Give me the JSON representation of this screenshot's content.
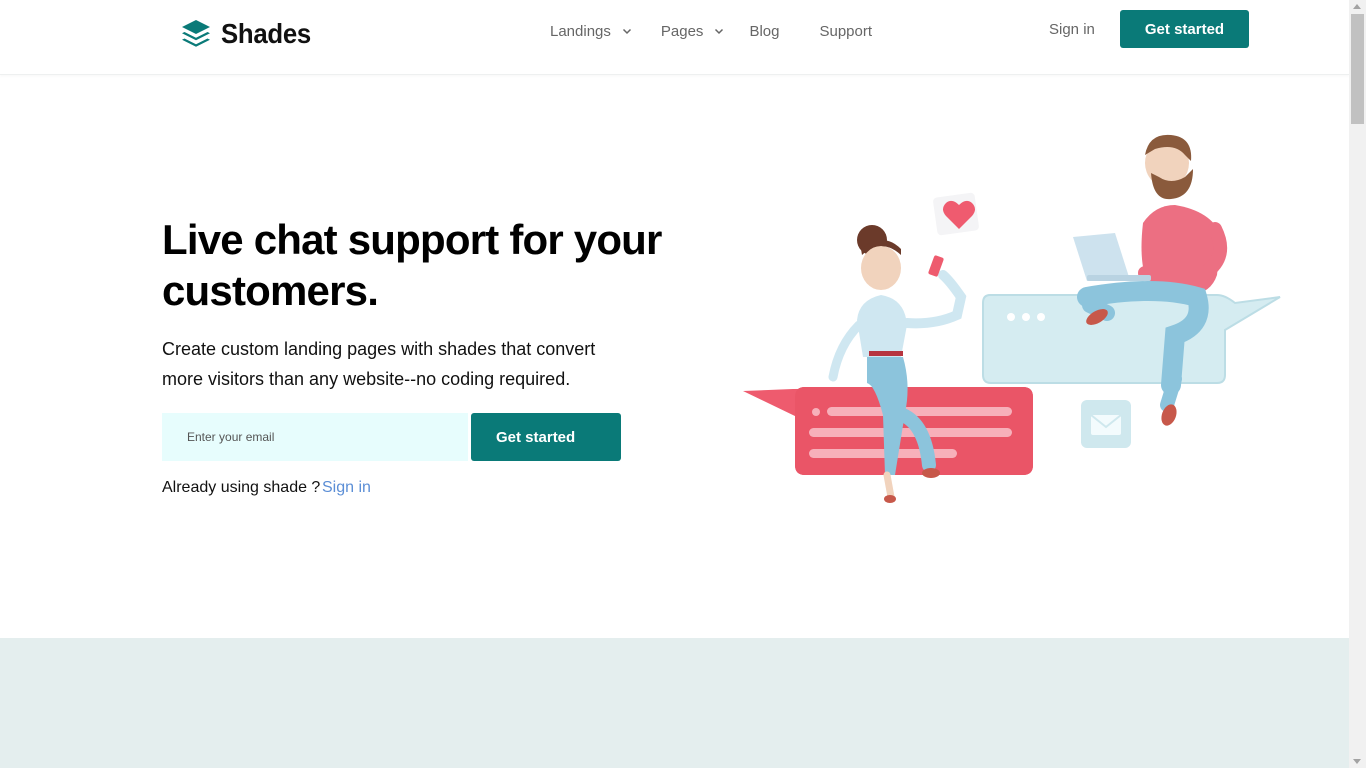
{
  "brand": {
    "name": "Shades",
    "accent": "#0a7a78"
  },
  "nav": {
    "items": [
      {
        "label": "Landings",
        "has_dropdown": true
      },
      {
        "label": "Pages",
        "has_dropdown": true
      },
      {
        "label": "Blog",
        "has_dropdown": false
      },
      {
        "label": "Support",
        "has_dropdown": false
      }
    ],
    "sign_in": "Sign in",
    "cta": "Get started"
  },
  "hero": {
    "title": "Live chat support for your customers.",
    "subtitle": "Create custom landing pages with shades that convert more visitors than any website--no coding required.",
    "email_placeholder": "Enter your email",
    "cta": "Get started",
    "already_text": "Already using shade ?",
    "sign_in_link": "Sign in",
    "link_color": "#5b8ed6"
  },
  "section_band_color": "#e4eeee"
}
